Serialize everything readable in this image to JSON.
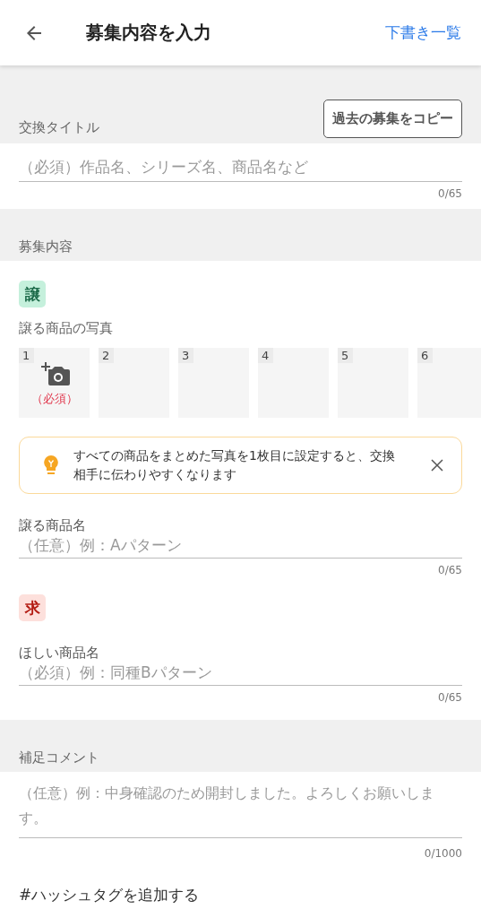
{
  "header": {
    "title": "募集内容を入力",
    "drafts_link": "下書き一覧"
  },
  "title_section": {
    "label": "交換タイトル",
    "copy_button": "過去の募集をコピー",
    "placeholder": "（必須）作品名、シリーズ名、商品名など",
    "count": "0/65"
  },
  "content_section": {
    "label": "募集内容"
  },
  "give": {
    "badge": "譲",
    "photos_label": "譲る商品の写真",
    "photos": [
      {
        "number": "1",
        "hint": "（必須）"
      },
      {
        "number": "2"
      },
      {
        "number": "3"
      },
      {
        "number": "4"
      },
      {
        "number": "5"
      },
      {
        "number": "6"
      }
    ],
    "tip": {
      "text": "すべての商品をまとめた写真を1枚目に設定すると、交換相手に伝わりやすくなります"
    },
    "name_label": "譲る商品名",
    "name_placeholder": "（任意）例：Aパターン",
    "name_count": "0/65"
  },
  "want": {
    "badge": "求",
    "name_label": "ほしい商品名",
    "name_placeholder": "（必須）例：同種Bパターン",
    "name_count": "0/65"
  },
  "comment_section": {
    "label": "補足コメント",
    "placeholder": "（任意）例：中身確認のため開封しました。よろしくお願いします。",
    "count": "0/1000"
  },
  "hashtag_link": "#ハッシュタグを追加する"
}
